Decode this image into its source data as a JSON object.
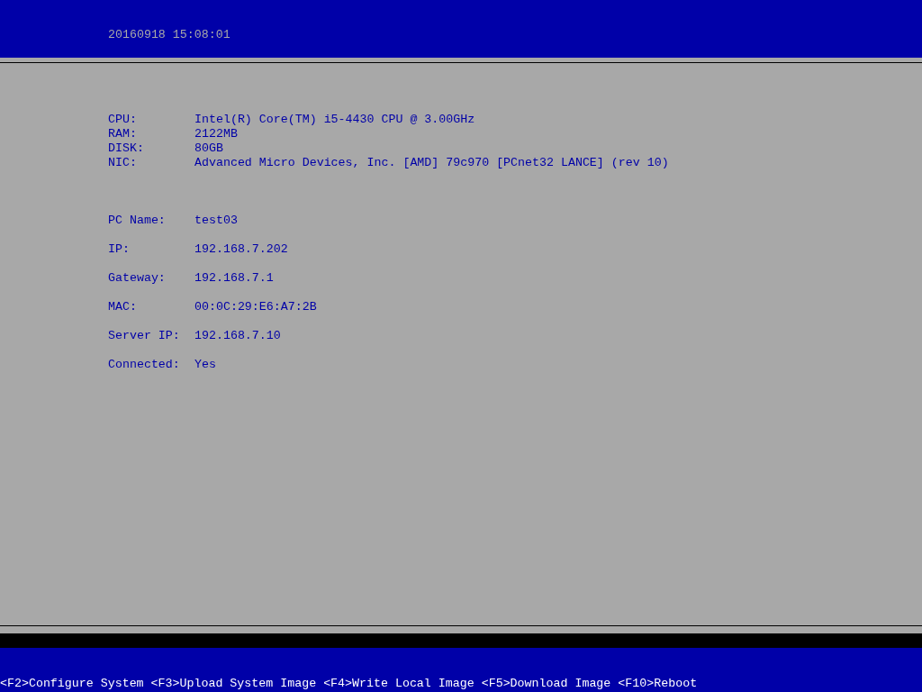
{
  "header": {
    "timestamp": "20160918 15:08:01"
  },
  "hardware": [
    {
      "label": "CPU:",
      "value": "Intel(R) Core(TM) i5-4430 CPU @ 3.00GHz"
    },
    {
      "label": "RAM:",
      "value": "2122MB"
    },
    {
      "label": "DISK:",
      "value": "80GB"
    },
    {
      "label": "NIC:",
      "value": "Advanced Micro Devices, Inc. [AMD] 79c970 [PCnet32 LANCE] (rev 10)"
    }
  ],
  "network": [
    {
      "label": "PC Name:",
      "value": "test03"
    },
    {
      "label": "IP:",
      "value": "192.168.7.202"
    },
    {
      "label": "Gateway:",
      "value": "192.168.7.1"
    },
    {
      "label": "MAC:",
      "value": "00:0C:29:E6:A7:2B"
    },
    {
      "label": "Server IP:",
      "value": "192.168.7.10"
    },
    {
      "label": "Connected:",
      "value": "Yes"
    }
  ],
  "function_keys": [
    "<F2>Configure System",
    "<F3>Upload System Image",
    "<F4>Write Local Image",
    "<F5>Download Image",
    "<F10>Reboot"
  ]
}
